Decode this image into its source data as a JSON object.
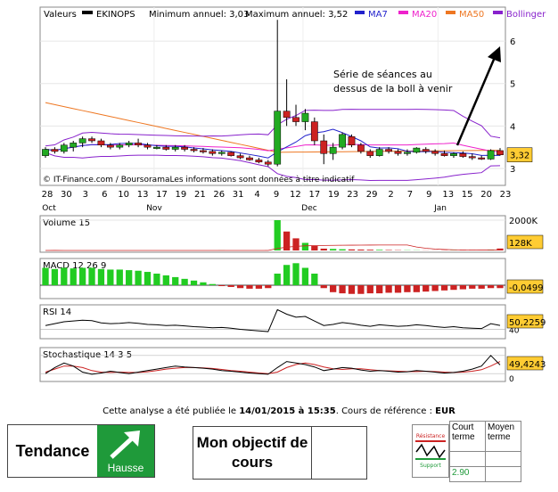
{
  "chart_data": {
    "type": "candlestick",
    "title": "Valeurs",
    "ticker": "EKINOPS",
    "min_annuel_label": "Minimum annuel: 3,03",
    "max_annuel_label": "Maximum annuel: 3,52",
    "legend": [
      {
        "name": "MA7",
        "color": "#2222cc"
      },
      {
        "name": "MA20",
        "color": "#ee22cc"
      },
      {
        "name": "MA50",
        "color": "#ee7722"
      },
      {
        "name": "Bollinger",
        "color": "#8822cc"
      }
    ],
    "ylim": [
      2.6,
      6.8
    ],
    "y_ticks": [
      "3",
      "4",
      "5",
      "6"
    ],
    "x_ticks": [
      "28",
      "30",
      "3",
      "6",
      "10",
      "13",
      "17",
      "19",
      "21",
      "26",
      "31",
      "4",
      "9",
      "12",
      "17",
      "19",
      "23",
      "29",
      "2",
      "7",
      "9",
      "13",
      "15",
      "20",
      "23"
    ],
    "months": [
      "Oct",
      "Nov",
      "Dec",
      "Jan"
    ],
    "last_price_label": "3,32",
    "copyright": "© IT-Finance.com / BoursoramaLes informations sont données à titre indicatif",
    "annotation": [
      "Série de séances au",
      "dessus de la boll à venir"
    ],
    "candles": [
      [
        3.3,
        3.5,
        3.25,
        3.45
      ],
      [
        3.45,
        3.5,
        3.35,
        3.4
      ],
      [
        3.4,
        3.6,
        3.35,
        3.55
      ],
      [
        3.5,
        3.65,
        3.4,
        3.6
      ],
      [
        3.6,
        3.75,
        3.5,
        3.7
      ],
      [
        3.7,
        3.75,
        3.6,
        3.65
      ],
      [
        3.65,
        3.7,
        3.5,
        3.55
      ],
      [
        3.55,
        3.6,
        3.45,
        3.5
      ],
      [
        3.5,
        3.6,
        3.45,
        3.55
      ],
      [
        3.55,
        3.65,
        3.5,
        3.6
      ],
      [
        3.6,
        3.7,
        3.5,
        3.55
      ],
      [
        3.55,
        3.6,
        3.45,
        3.5
      ],
      [
        3.5,
        3.55,
        3.45,
        3.5
      ],
      [
        3.5,
        3.55,
        3.42,
        3.45
      ],
      [
        3.45,
        3.55,
        3.4,
        3.5
      ],
      [
        3.5,
        3.55,
        3.4,
        3.45
      ],
      [
        3.45,
        3.5,
        3.38,
        3.42
      ],
      [
        3.42,
        3.48,
        3.35,
        3.4
      ],
      [
        3.4,
        3.45,
        3.3,
        3.35
      ],
      [
        3.35,
        3.42,
        3.3,
        3.38
      ],
      [
        3.38,
        3.4,
        3.28,
        3.3
      ],
      [
        3.3,
        3.35,
        3.22,
        3.25
      ],
      [
        3.25,
        3.3,
        3.18,
        3.2
      ],
      [
        3.2,
        3.25,
        3.12,
        3.15
      ],
      [
        3.15,
        3.2,
        3.05,
        3.1
      ],
      [
        3.1,
        6.5,
        3.05,
        4.35
      ],
      [
        4.35,
        5.1,
        4.0,
        4.2
      ],
      [
        4.2,
        4.5,
        4.0,
        4.1
      ],
      [
        4.1,
        4.4,
        3.9,
        4.3
      ],
      [
        4.1,
        4.2,
        3.55,
        3.65
      ],
      [
        3.65,
        3.8,
        3.1,
        3.35
      ],
      [
        3.35,
        3.6,
        3.2,
        3.5
      ],
      [
        3.5,
        3.85,
        3.45,
        3.8
      ],
      [
        3.75,
        3.8,
        3.5,
        3.55
      ],
      [
        3.55,
        3.6,
        3.35,
        3.4
      ],
      [
        3.4,
        3.45,
        3.25,
        3.3
      ],
      [
        3.3,
        3.5,
        3.28,
        3.45
      ],
      [
        3.45,
        3.5,
        3.35,
        3.4
      ],
      [
        3.4,
        3.45,
        3.3,
        3.35
      ],
      [
        3.35,
        3.45,
        3.3,
        3.38
      ],
      [
        3.38,
        3.5,
        3.35,
        3.48
      ],
      [
        3.45,
        3.5,
        3.35,
        3.4
      ],
      [
        3.4,
        3.45,
        3.3,
        3.35
      ],
      [
        3.35,
        3.42,
        3.28,
        3.3
      ],
      [
        3.3,
        3.38,
        3.25,
        3.35
      ],
      [
        3.35,
        3.4,
        3.25,
        3.28
      ],
      [
        3.28,
        3.35,
        3.2,
        3.25
      ],
      [
        3.25,
        3.3,
        3.2,
        3.22
      ],
      [
        3.22,
        3.45,
        3.2,
        3.42
      ],
      [
        3.42,
        3.48,
        3.3,
        3.32
      ]
    ],
    "volume": {
      "label": "Volume 15",
      "ticks": [
        "2000K"
      ],
      "last_label": "128K",
      "values": [
        0,
        5,
        0,
        0,
        0,
        0,
        0,
        0,
        0,
        0,
        0,
        0,
        0,
        0,
        0,
        0,
        0,
        0,
        0,
        8,
        0,
        0,
        0,
        0,
        10,
        2000,
        1250,
        800,
        500,
        300,
        120,
        100,
        80,
        70,
        60,
        50,
        40,
        30,
        20,
        15,
        12,
        10,
        10,
        10,
        12,
        15,
        20,
        25,
        60,
        128
      ]
    },
    "macd": {
      "label": "MACD 12 26 9",
      "last_label": "-0,0499",
      "values": [
        0.3,
        0.28,
        0.3,
        0.29,
        0.3,
        0.3,
        0.28,
        0.27,
        0.27,
        0.26,
        0.25,
        0.23,
        0.2,
        0.17,
        0.14,
        0.11,
        0.08,
        0.05,
        0.02,
        -0.01,
        -0.03,
        -0.05,
        -0.06,
        -0.06,
        -0.05,
        0.2,
        0.35,
        0.38,
        0.3,
        0.2,
        -0.05,
        -0.12,
        -0.14,
        -0.15,
        -0.15,
        -0.14,
        -0.14,
        -0.13,
        -0.13,
        -0.12,
        -0.12,
        -0.11,
        -0.1,
        -0.09,
        -0.08,
        -0.07,
        -0.06,
        -0.06,
        -0.05,
        -0.0499
      ]
    },
    "rsi": {
      "label": "RSI 14",
      "ticks": [
        "40"
      ],
      "last_label": "50,2259",
      "values": [
        50,
        55,
        60,
        62,
        64,
        63,
        57,
        55,
        56,
        58,
        56,
        53,
        52,
        50,
        51,
        49,
        47,
        46,
        44,
        45,
        43,
        40,
        38,
        36,
        34,
        92,
        80,
        72,
        74,
        62,
        50,
        53,
        58,
        55,
        51,
        48,
        52,
        50,
        48,
        49,
        52,
        50,
        47,
        45,
        47,
        44,
        43,
        42,
        55,
        50.2259
      ]
    },
    "stoch": {
      "label": "Stochastique 14 3 5",
      "ticks": [
        "0"
      ],
      "last_label": "49,4243",
      "k": [
        20,
        40,
        55,
        45,
        25,
        18,
        22,
        28,
        24,
        20,
        25,
        30,
        35,
        40,
        45,
        42,
        40,
        38,
        35,
        30,
        28,
        25,
        22,
        20,
        18,
        40,
        60,
        55,
        50,
        42,
        30,
        35,
        40,
        38,
        32,
        28,
        30,
        28,
        25,
        26,
        30,
        28,
        25,
        22,
        24,
        28,
        35,
        45,
        80,
        49
      ],
      "d": [
        25,
        35,
        45,
        45,
        40,
        30,
        25,
        24,
        25,
        24,
        24,
        26,
        30,
        35,
        38,
        40,
        40,
        39,
        37,
        34,
        30,
        28,
        25,
        22,
        20,
        25,
        40,
        50,
        55,
        50,
        42,
        36,
        34,
        36,
        36,
        33,
        30,
        29,
        28,
        27,
        27,
        28,
        27,
        25,
        24,
        25,
        28,
        33,
        45,
        60
      ]
    }
  },
  "footer": {
    "prefix": "Cette analyse a été publiée le ",
    "date": "14/01/2015 à 15:35",
    "middle": ". Cours de référence : ",
    "currency": "EUR"
  },
  "tendance": {
    "label": "Tendance",
    "value": "Hausse"
  },
  "objectif": {
    "label": "Mon objectif de cours"
  },
  "support_resistance": {
    "logo_top": "Résistance",
    "logo_bottom": "Support",
    "court_terme": "Court terme",
    "moyen_terme": "Moyen terme",
    "support_court": "2.90"
  },
  "colors": {
    "up": "#22aa22",
    "down": "#cc2222",
    "label_bg": "#ffcc33",
    "volume": "#22cc22"
  }
}
